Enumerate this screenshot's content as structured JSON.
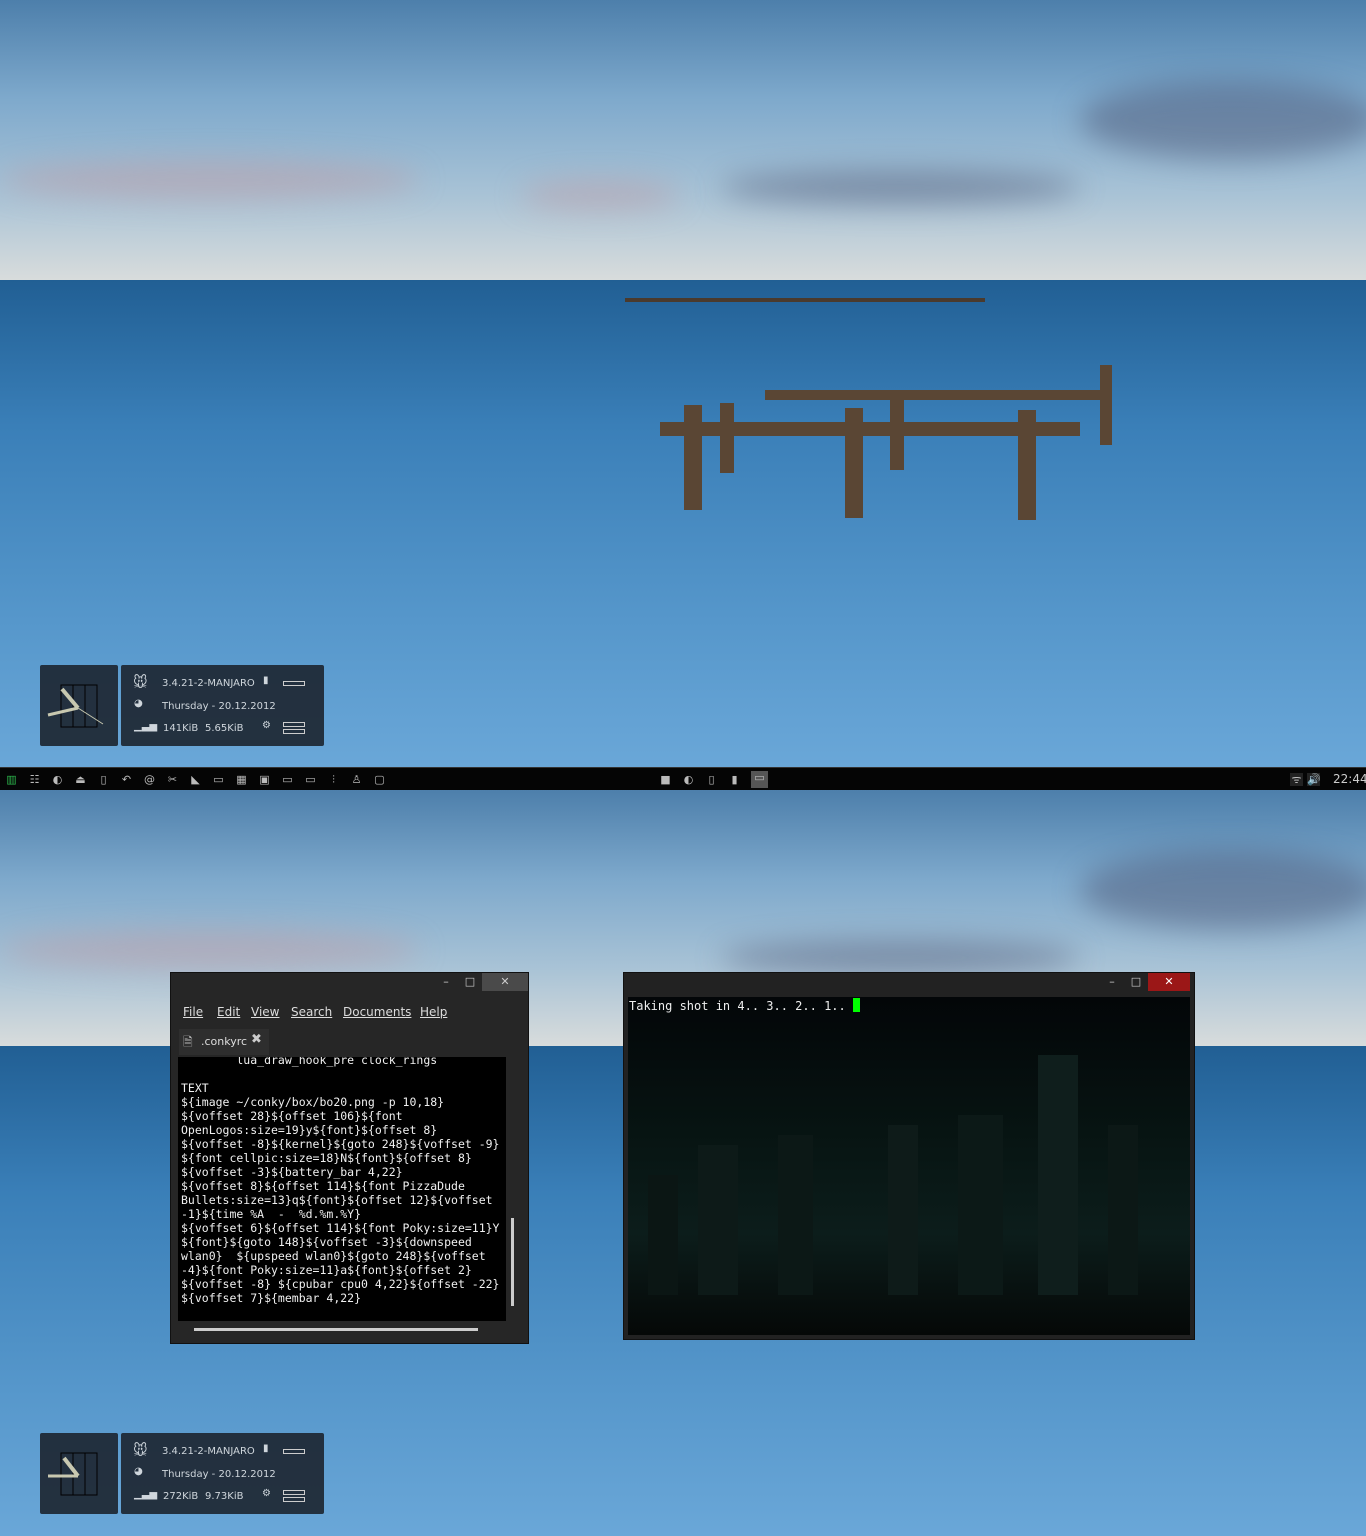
{
  "conky": [
    {
      "kernel": "3.4.21-2-MANJARO",
      "date": "Thursday  -  20.12.2012",
      "down": "141KiB",
      "up": "5.65KiB"
    },
    {
      "kernel": "3.4.21-2-MANJARO",
      "date": "Thursday  -  20.12.2012",
      "down": "272KiB",
      "up": "9.73KiB"
    }
  ],
  "taskbar": {
    "launchers": [
      "manjaro-menu-icon",
      "file-cabinet-icon",
      "firefox-icon",
      "package-installer-icon",
      "media-player-icon",
      "undo-icon",
      "at-sign-icon",
      "tools-icon",
      "bird-icon",
      "calendar-icon",
      "calculator-icon",
      "image-viewer-icon",
      "terminal-icon",
      "monitor-icon",
      "mixer-icon",
      "tux-icon",
      "window-icon"
    ],
    "tasks": [
      "folder-icon",
      "firefox-icon",
      "media-player-icon",
      "document-icon",
      "terminal-icon"
    ],
    "clock": "22:44",
    "accent": "#2db84d"
  },
  "editor": {
    "menu": [
      "File",
      "Edit",
      "View",
      "Search",
      "Documents",
      "Help"
    ],
    "tab": ".conkyrc",
    "content": "        lua_draw_hook_pre clock_rings\n\nTEXT\n${image ~/conky/box/bo20.png -p 10,18}\n${voffset 28}${offset 106}${font\nOpenLogos:size=19}y${font}${offset 8}\n${voffset -8}${kernel}${goto 248}${voffset -9}\n${font cellpic:size=18}N${font}${offset 8}\n${voffset -3}${battery_bar 4,22}\n${voffset 8}${offset 114}${font PizzaDude\nBullets:size=13}q${font}${offset 12}${voffset\n-1}${time %A  -  %d.%m.%Y}\n${voffset 6}${offset 114}${font Poky:size=11}Y\n${font}${goto 148}${voffset -3}${downspeed\nwlan0}  ${upspeed wlan0}${goto 248}${voffset\n-4}${font Poky:size=11}a${font}${offset 2}\n${voffset -8} ${cpubar cpu0 4,22}${offset -22}\n${voffset 7}${membar 4,22}"
  },
  "terminal": {
    "text": "Taking shot in 4.. 3.. 2.. 1.. ",
    "cursor_color": "#00ff00",
    "close_color": "#9b1717"
  },
  "window_buttons": {
    "minimize": "–",
    "maximize": "□",
    "close": "✕"
  }
}
